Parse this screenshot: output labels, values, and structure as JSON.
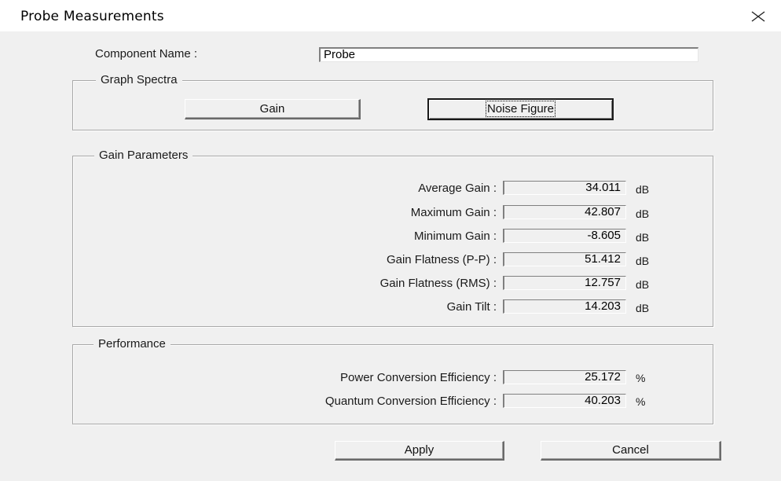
{
  "window": {
    "title": "Probe Measurements"
  },
  "component": {
    "label": "Component Name :",
    "value": "Probe"
  },
  "graph_spectra": {
    "legend": "Graph Spectra",
    "gain_button": "Gain",
    "noise_figure_button": "Noise Figure"
  },
  "gain_parameters": {
    "legend": "Gain Parameters",
    "rows": [
      {
        "label": "Average Gain :",
        "value": "34.011",
        "unit": "dB"
      },
      {
        "label": "Maximum Gain :",
        "value": "42.807",
        "unit": "dB"
      },
      {
        "label": "Minimum Gain :",
        "value": "-8.605",
        "unit": "dB"
      },
      {
        "label": "Gain Flatness (P-P) :",
        "value": "51.412",
        "unit": "dB"
      },
      {
        "label": "Gain Flatness (RMS) :",
        "value": "12.757",
        "unit": "dB"
      },
      {
        "label": "Gain Tilt :",
        "value": "14.203",
        "unit": "dB"
      }
    ]
  },
  "performance": {
    "legend": "Performance",
    "rows": [
      {
        "label": "Power Conversion Efficiency :",
        "value": "25.172",
        "unit": "%"
      },
      {
        "label": "Quantum Conversion Efficiency :",
        "value": "40.203",
        "unit": "%"
      }
    ]
  },
  "footer": {
    "apply_button": "Apply",
    "cancel_button": "Cancel"
  },
  "icons": {
    "close": "close-icon"
  }
}
